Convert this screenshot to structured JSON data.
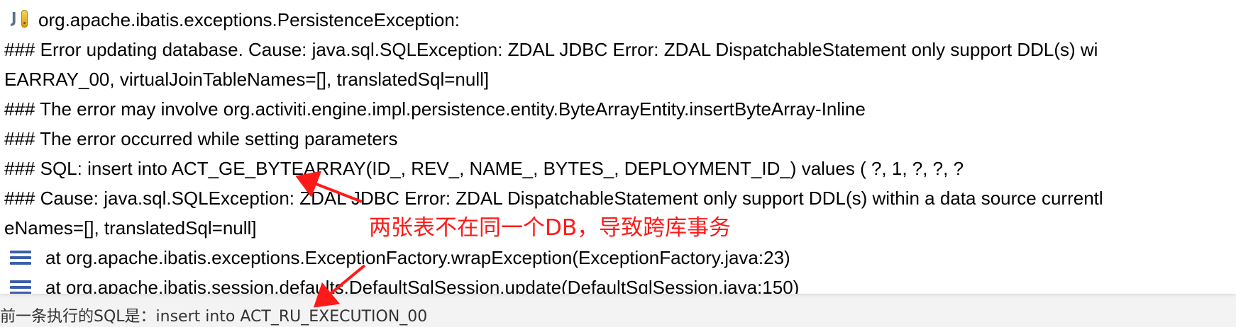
{
  "console": {
    "exception_icon": "java-exception-warning-icon",
    "exception_title": "org.apache.ibatis.exceptions.PersistenceException:",
    "lines": [
      "### Error updating database.  Cause: java.sql.SQLException: ZDAL JDBC Error: ZDAL DispatchableStatement only support DDL(s) wi",
      "EARRAY_00, virtualJoinTableNames=[], translatedSql=null]",
      "### The error may involve org.activiti.engine.impl.persistence.entity.ByteArrayEntity.insertByteArray-Inline",
      "### The error occurred while setting parameters",
      "### SQL: insert into ACT_GE_BYTEARRAY(ID_, REV_, NAME_, BYTES_, DEPLOYMENT_ID_)     values (       ?,        1,        ?,        ?,        ?",
      "### Cause: java.sql.SQLException: ZDAL JDBC Error: ZDAL DispatchableStatement only support DDL(s) within a data source currentl",
      "eNames=[], translatedSql=null]"
    ],
    "stack_icon": "stack-frame-icon",
    "stack": [
      "at org.apache.ibatis.exceptions.ExceptionFactory.wrapException(ExceptionFactory.java:23)",
      "at org.apache.ibatis.session.defaults.DefaultSqlSession.update(DefaultSqlSession.java:150)"
    ]
  },
  "annotation": {
    "text": "两张表不在同一个DB，导致跨库事务",
    "color": "#ff1a1a"
  },
  "caption": {
    "text": "前一条执行的SQL是：insert into ACT_RU_EXECUTION_00"
  },
  "colors": {
    "console_bg": "#ffffff",
    "page_bg": "#f3f3f3",
    "stack_icon": "#3a5fa8",
    "arrow": "#ff1a1a"
  }
}
